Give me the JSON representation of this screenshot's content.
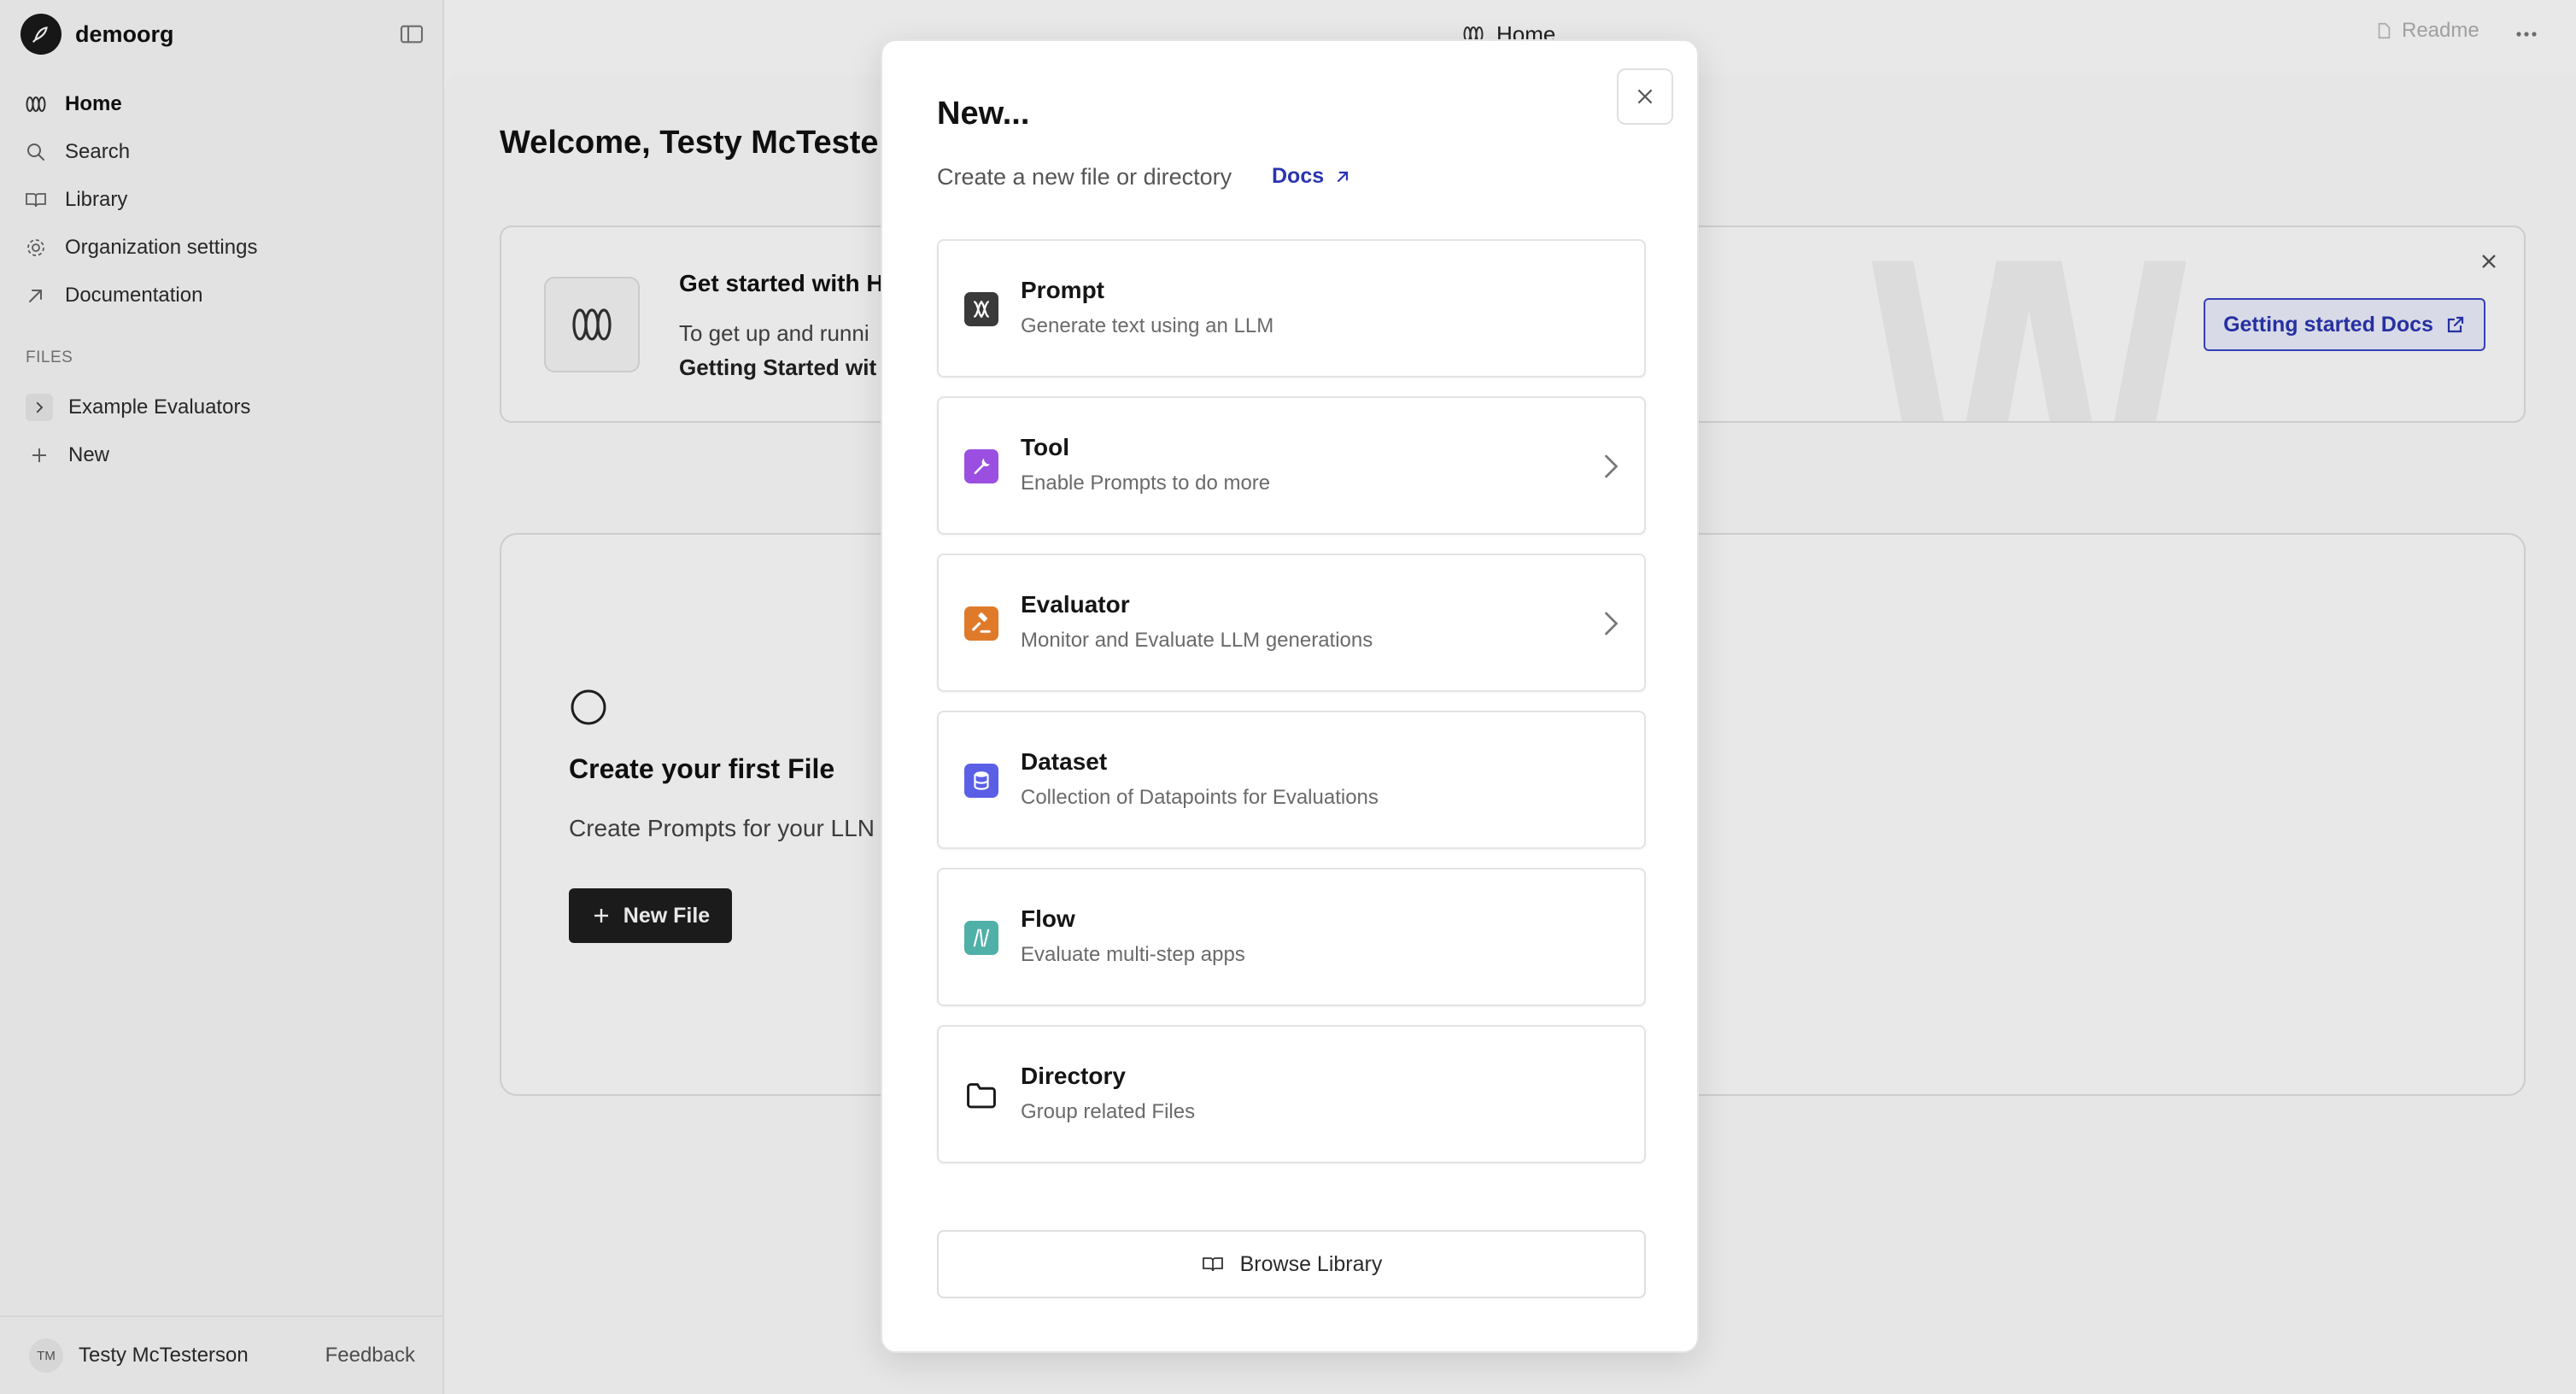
{
  "sidebar": {
    "org_name": "demoorg",
    "nav": [
      {
        "label": "Home",
        "icon": "home-icon"
      },
      {
        "label": "Search",
        "icon": "search-icon"
      },
      {
        "label": "Library",
        "icon": "book-icon"
      },
      {
        "label": "Organization settings",
        "icon": "gear-icon"
      },
      {
        "label": "Documentation",
        "icon": "arrow-up-right-icon"
      }
    ],
    "files_label": "FILES",
    "files": [
      {
        "label": "Example Evaluators",
        "icon": "chevron-right-icon"
      },
      {
        "label": "New",
        "icon": "plus-icon"
      }
    ],
    "user_initials": "TM",
    "user_name": "Testy McTesterson",
    "feedback_label": "Feedback"
  },
  "topbar": {
    "title": "Home",
    "readme_label": "Readme"
  },
  "main": {
    "welcome": "Welcome, Testy McTester",
    "banner": {
      "title": "Get started with H",
      "text_line1": "To get up and runni",
      "text_line2": "Getting Started wit",
      "button_label": "Getting started Docs"
    },
    "empty_state": {
      "title": "Create your first File",
      "subtitle": "Create Prompts for your LLN",
      "button_label": "New File"
    }
  },
  "modal": {
    "title": "New...",
    "subtitle": "Create a new file or directory",
    "docs_label": "Docs",
    "options": [
      {
        "title": "Prompt",
        "description": "Generate text using an LLM",
        "icon": "prompt-icon",
        "color": "#3a3a3a",
        "has_chevron": false
      },
      {
        "title": "Tool",
        "description": "Enable Prompts to do more",
        "icon": "wrench-icon",
        "color": "#9b4fe0",
        "has_chevron": true
      },
      {
        "title": "Evaluator",
        "description": "Monitor and Evaluate LLM generations",
        "icon": "gavel-icon",
        "color": "#e07a2b",
        "has_chevron": true
      },
      {
        "title": "Dataset",
        "description": "Collection of Datapoints for Evaluations",
        "icon": "database-icon",
        "color": "#5b5fe6",
        "has_chevron": false
      },
      {
        "title": "Flow",
        "description": "Evaluate multi-step apps",
        "icon": "flow-icon",
        "color": "#4fb0a8",
        "has_chevron": false
      },
      {
        "title": "Directory",
        "description": "Group related Files",
        "icon": "folder-icon",
        "color": "#ffffff",
        "has_chevron": false
      }
    ],
    "browse_label": "Browse Library"
  }
}
